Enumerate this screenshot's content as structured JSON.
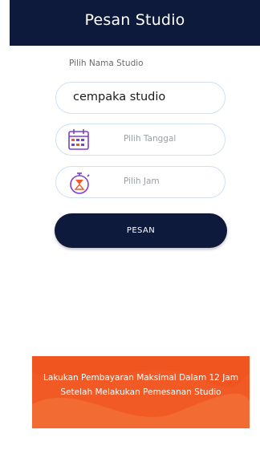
{
  "header": {
    "title": "Pesan Studio"
  },
  "form": {
    "studio_label": "Pilih Nama Studio",
    "studio_value": "cempaka studio",
    "date_placeholder": "Pilih Tanggal",
    "time_placeholder": "Pilih Jam",
    "date_icon": "calendar-icon",
    "time_icon": "stopwatch-icon",
    "submit_label": "PESAN"
  },
  "notice": {
    "text": "Lakukan Pembayaran Maksimal Dalam 12 Jam Setelah Melakukan Pemesanan Studio"
  },
  "colors": {
    "primary": "#0d1a3c",
    "notice": "#f15a24",
    "field_border": "#cfe0f4",
    "icon_accent": "#7b3fd6"
  }
}
